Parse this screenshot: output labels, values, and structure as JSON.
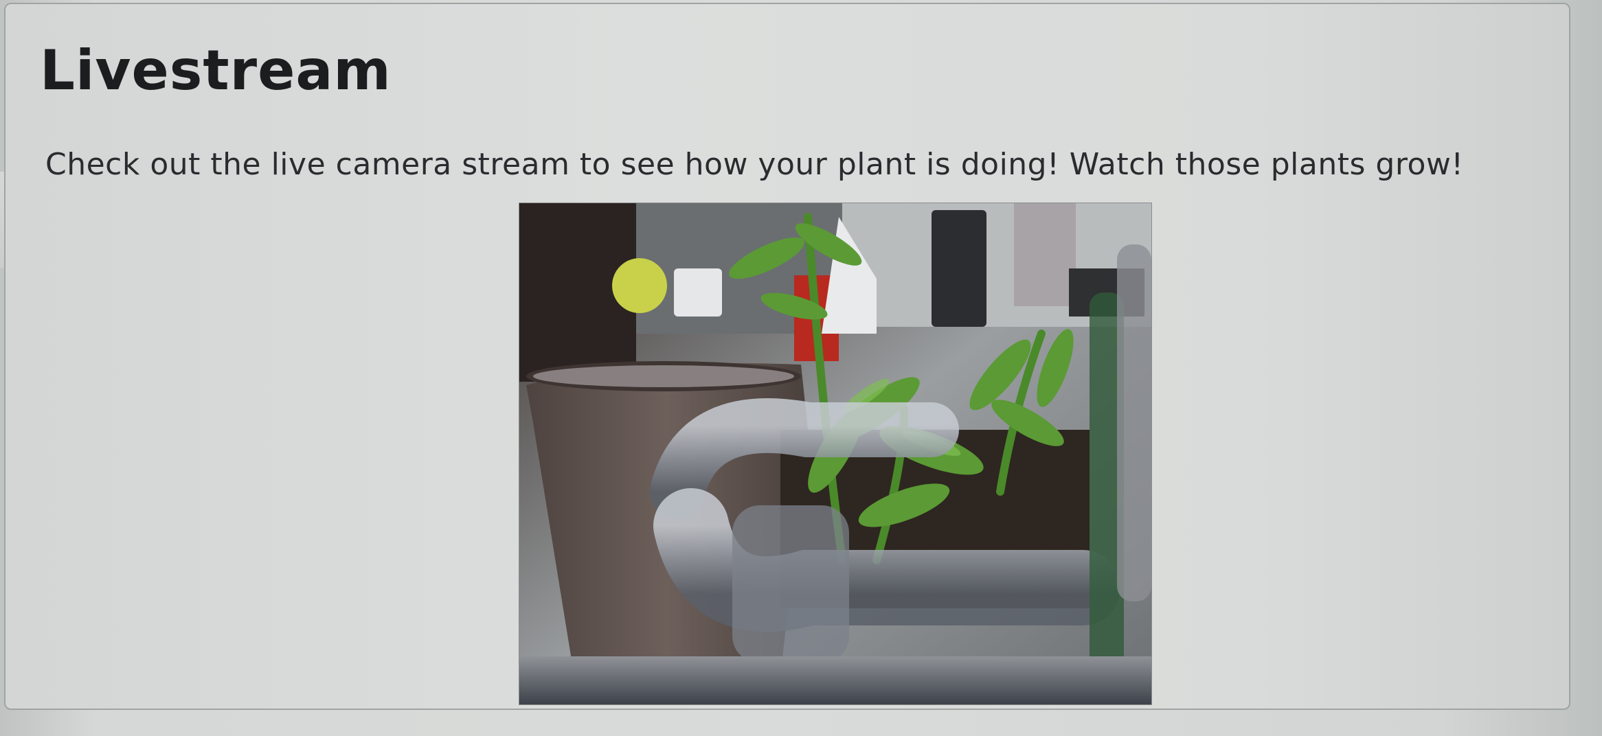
{
  "section": {
    "title": "Livestream",
    "description": "Check out the live camera stream to see how your plant is doing! Watch those plants grow!"
  },
  "livestream": {
    "content": "camera-feed-plant-pot"
  },
  "colors": {
    "background": "#d9dbda",
    "card_border": "#9fa3a2",
    "title_text": "#1c1d1f",
    "body_text": "#2a2b2e"
  }
}
